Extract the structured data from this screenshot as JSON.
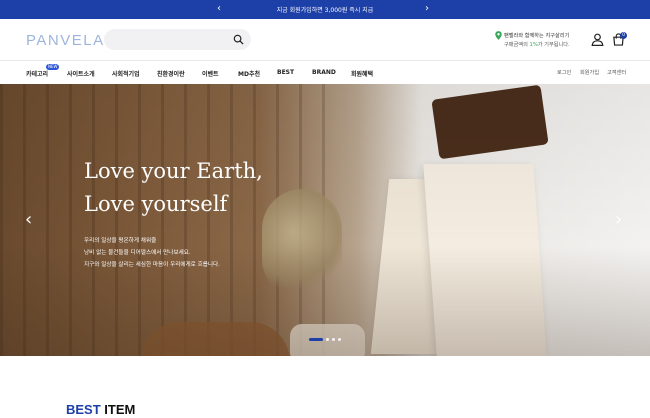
{
  "promo": {
    "text": "지금 회원가입하면 3,000원 즉시 지급",
    "prev_icon": "chevron-left-icon",
    "next_icon": "chevron-right-icon"
  },
  "header": {
    "logo": "PANVELA",
    "search_placeholder": "",
    "search_icon": "search-icon",
    "green_msg_line1": "팬벨라와 함께하는 지구살리기",
    "green_msg_line2_prefix": "구매금액의 ",
    "green_msg_line2_highlight": "1%",
    "green_msg_line2_suffix": "가 기부됩니다.",
    "pin_icon": "map-pin-icon",
    "user_icon": "user-icon",
    "cart_icon": "shopping-bag-icon",
    "cart_count": "0"
  },
  "nav": {
    "items": [
      "카테고리",
      "사이트소개",
      "사회적기업",
      "친환경이란",
      "이벤트",
      "MD추천",
      "BEST",
      "BRAND",
      "회원혜택"
    ],
    "new_badge": "NEW",
    "util": [
      "로그인",
      "회원가입",
      "고객센터"
    ]
  },
  "hero": {
    "title_line1": "Love your Earth,",
    "title_line2": "Love yourself",
    "desc_line1": "우리의 일상을 평온하게 채워줄",
    "desc_line2": "낭비 없는 물건들을 디어얼스에서 만나보세요.",
    "desc_line3": "지구와 일상을 살리는 세심한 마음이 우리에게로 흐릅니다.",
    "prev_icon": "chevron-left-icon",
    "next_icon": "chevron-right-icon",
    "slides": 4,
    "active_slide": 1
  },
  "section": {
    "best_prefix": "BEST",
    "best_suffix": " ITEM"
  },
  "colors": {
    "brand": "#1d3fa8",
    "logo": "#9db5dc",
    "green": "#3aa85b"
  }
}
